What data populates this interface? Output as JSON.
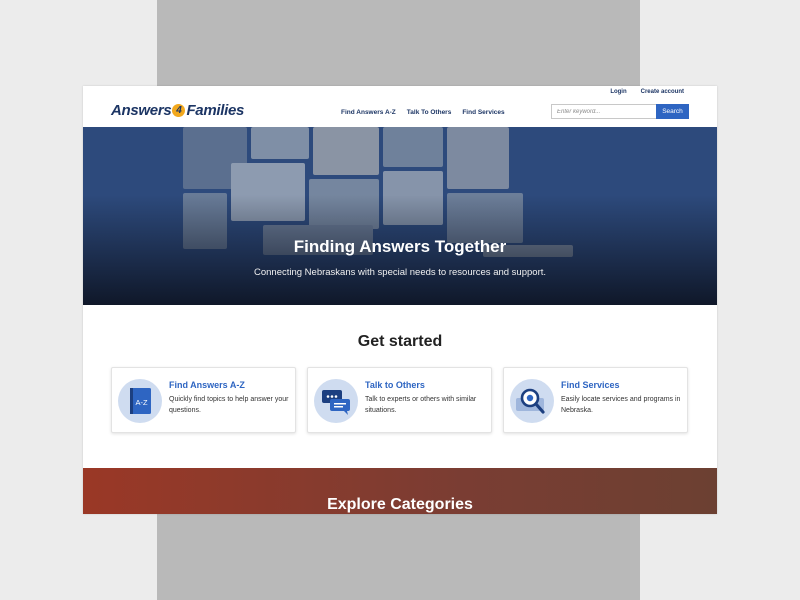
{
  "header": {
    "logo_left": "Answers",
    "logo_number": "4",
    "logo_right": "Families",
    "utility_links": [
      "Login",
      "Create account"
    ],
    "nav": [
      "Find Answers A-Z",
      "Talk To Others",
      "Find Services"
    ],
    "search": {
      "placeholder": "Enter keyword...",
      "button": "Search"
    }
  },
  "hero": {
    "title": "Finding Answers Together",
    "subtitle": "Connecting Nebraskans with special needs to resources and support."
  },
  "get_started": {
    "title": "Get started",
    "cards": [
      {
        "title": "Find Answers A-Z",
        "text": "Quickly find topics to help answer your questions.",
        "icon": "book-icon",
        "icon_text": "A-Z"
      },
      {
        "title": "Talk to Others",
        "text": "Talk to experts or others with similar situations.",
        "icon": "chat-bubbles-icon"
      },
      {
        "title": "Find Services",
        "text": "Easily locate services and programs in Nebraska.",
        "icon": "magnifier-map-icon"
      }
    ]
  },
  "explore": {
    "title": "Explore Categories"
  },
  "colors": {
    "brand_navy": "#1c3564",
    "accent_blue": "#2e65c2",
    "logo_orange": "#f2a81d",
    "explore_band": "#8a3a2c"
  }
}
